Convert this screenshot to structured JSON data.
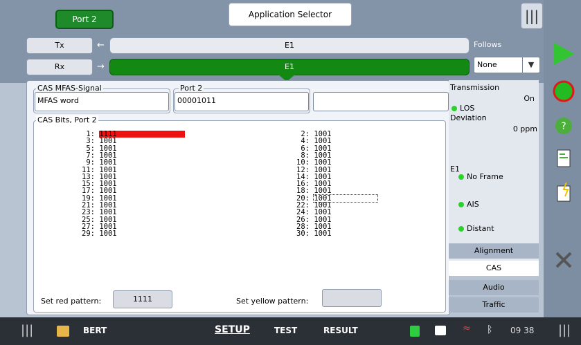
{
  "header": {
    "port_tab": "Port 2",
    "app_selector": "Application Selector",
    "tx_label": "Tx",
    "rx_label": "Rx",
    "tx_bar": "E1",
    "rx_bar": "E1",
    "follows_label": "Follows",
    "follows_value": "None"
  },
  "main": {
    "cas_signal": {
      "title": "CAS MFAS-Signal",
      "value": "MFAS word"
    },
    "port_group": {
      "title": "Port 2",
      "value": "00001011"
    },
    "third_field": "",
    "cas_bits": {
      "title": "CAS Bits, Port 2",
      "left": [
        {
          "n": "1:",
          "v": "1111"
        },
        {
          "n": "3:",
          "v": "1001"
        },
        {
          "n": "5:",
          "v": "1001"
        },
        {
          "n": "7:",
          "v": "1001"
        },
        {
          "n": "9:",
          "v": "1001"
        },
        {
          "n": "11:",
          "v": "1001"
        },
        {
          "n": "13:",
          "v": "1001"
        },
        {
          "n": "15:",
          "v": "1001"
        },
        {
          "n": "17:",
          "v": "1001"
        },
        {
          "n": "19:",
          "v": "1001"
        },
        {
          "n": "21:",
          "v": "1001"
        },
        {
          "n": "23:",
          "v": "1001"
        },
        {
          "n": "25:",
          "v": "1001"
        },
        {
          "n": "27:",
          "v": "1001"
        },
        {
          "n": "29:",
          "v": "1001"
        }
      ],
      "right": [
        {
          "n": "2:",
          "v": "1001"
        },
        {
          "n": "4:",
          "v": "1001"
        },
        {
          "n": "6:",
          "v": "1001"
        },
        {
          "n": "8:",
          "v": "1001"
        },
        {
          "n": "10:",
          "v": "1001"
        },
        {
          "n": "12:",
          "v": "1001"
        },
        {
          "n": "14:",
          "v": "1001"
        },
        {
          "n": "16:",
          "v": "1001"
        },
        {
          "n": "18:",
          "v": "1001"
        },
        {
          "n": "20:",
          "v": "1001"
        },
        {
          "n": "22:",
          "v": "1001"
        },
        {
          "n": "24:",
          "v": "1001"
        },
        {
          "n": "26:",
          "v": "1001"
        },
        {
          "n": "28:",
          "v": "1001"
        },
        {
          "n": "30:",
          "v": "1001"
        }
      ]
    },
    "set_red_label": "Set red pattern:",
    "set_red_value": "1111",
    "set_yellow_label": "Set yellow pattern:",
    "set_yellow_value": ""
  },
  "status": {
    "transmission_label": "Transmission",
    "transmission_value": "On",
    "los": "LOS",
    "deviation_label": "Deviation",
    "deviation_value": "0 ppm",
    "e1_label": "E1",
    "no_frame": "No Frame",
    "ais": "AIS",
    "distant": "Distant"
  },
  "tabs": [
    "Alignment",
    "CAS",
    "Audio",
    "Traffic"
  ],
  "bottom": {
    "bert": "BERT",
    "setup": "SETUP",
    "test": "TEST",
    "result": "RESULT",
    "time": "09 38"
  },
  "colors": {
    "accent_green": "#138813",
    "red_marker": "#ee1111"
  }
}
